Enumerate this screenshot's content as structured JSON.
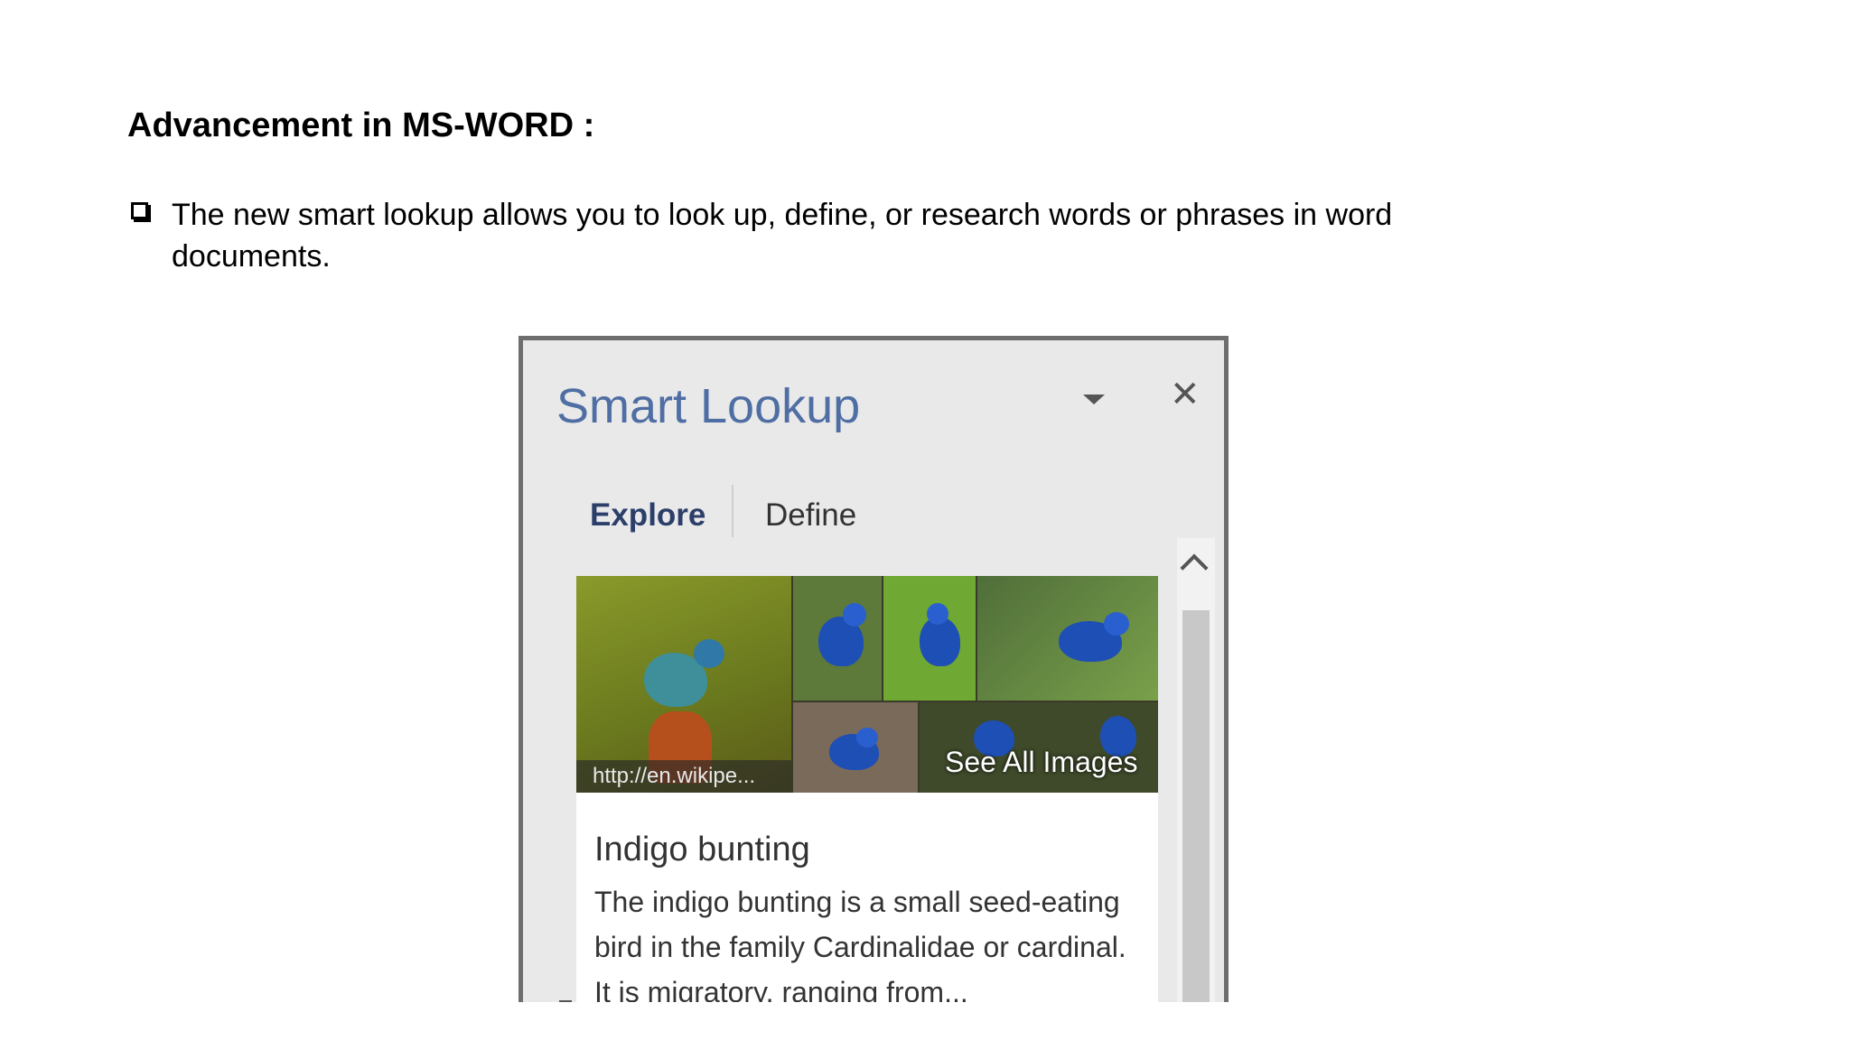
{
  "slide": {
    "title": "Advancement in MS-WORD :",
    "bullet": "The new smart lookup allows you to look up, define, or research words or phrases in word documents."
  },
  "panel": {
    "title": "Smart Lookup",
    "tabs": {
      "explore": "Explore",
      "define": "Define"
    },
    "gallery": {
      "caption": "http://en.wikipe...",
      "see_all": "See All Images"
    },
    "result": {
      "title": "Indigo bunting",
      "description": "The indigo bunting is a small seed-eating bird in the family Cardinalidae or cardinal. It is migratory, ranging from..."
    }
  },
  "colors": {
    "panel_title": "#4f6ea3",
    "tab_active": "#2b3f6a",
    "panel_bg": "#e9e9e9",
    "panel_border": "#6e6e6e"
  }
}
